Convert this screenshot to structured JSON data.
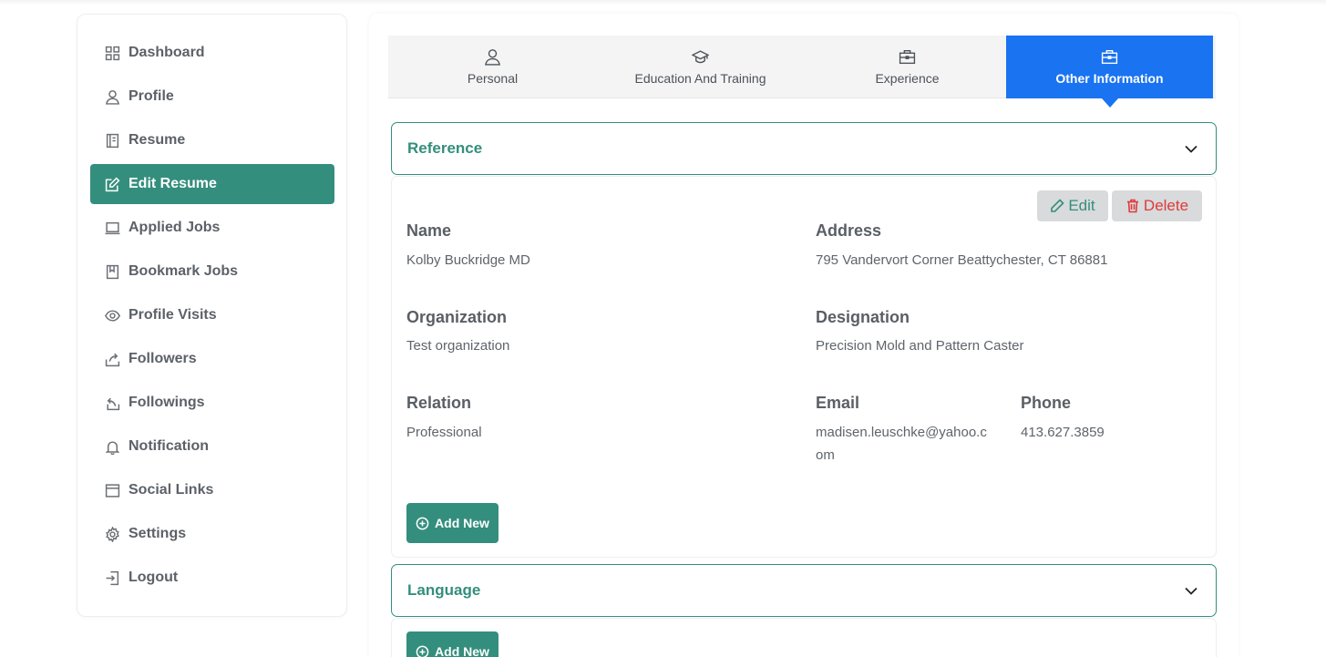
{
  "sidebar": {
    "items": [
      {
        "label": "Dashboard",
        "icon": "grid-icon"
      },
      {
        "label": "Profile",
        "icon": "user-icon"
      },
      {
        "label": "Resume",
        "icon": "document-icon"
      },
      {
        "label": "Edit Resume",
        "icon": "edit-icon",
        "active": true
      },
      {
        "label": "Applied Jobs",
        "icon": "laptop-icon"
      },
      {
        "label": "Bookmark Jobs",
        "icon": "bookmark-icon"
      },
      {
        "label": "Profile Visits",
        "icon": "eye-icon"
      },
      {
        "label": "Followers",
        "icon": "share-icon"
      },
      {
        "label": "Followings",
        "icon": "reply-icon"
      },
      {
        "label": "Notification",
        "icon": "bell-icon"
      },
      {
        "label": "Social Links",
        "icon": "window-icon"
      },
      {
        "label": "Settings",
        "icon": "gear-icon"
      },
      {
        "label": "Logout",
        "icon": "logout-icon"
      }
    ]
  },
  "tabs": [
    {
      "label": "Personal",
      "icon": "user-icon"
    },
    {
      "label": "Education And Training",
      "icon": "graduation-cap-icon"
    },
    {
      "label": "Experience",
      "icon": "briefcase-icon"
    },
    {
      "label": "Other Information",
      "icon": "briefcase-icon",
      "active": true
    }
  ],
  "reference": {
    "title": "Reference",
    "edit_label": "Edit",
    "delete_label": "Delete",
    "fields": {
      "name_label": "Name",
      "name_value": "Kolby Buckridge MD",
      "address_label": "Address",
      "address_value": "795 Vandervort Corner Beattychester, CT 86881",
      "organization_label": "Organization",
      "organization_value": "Test organization",
      "designation_label": "Designation",
      "designation_value": "Precision Mold and Pattern Caster",
      "relation_label": "Relation",
      "relation_value": "Professional",
      "email_label": "Email",
      "email_value_line1": "madisen.leuschke@yahoo.c",
      "email_value_line2": "om",
      "phone_label": "Phone",
      "phone_value": "413.627.3859"
    },
    "add_label": "Add New"
  },
  "language": {
    "title": "Language",
    "add_label": "Add New"
  },
  "colors": {
    "accent": "#348e7d",
    "tab_active": "#1a73f0",
    "delete": "#e03a3a"
  }
}
